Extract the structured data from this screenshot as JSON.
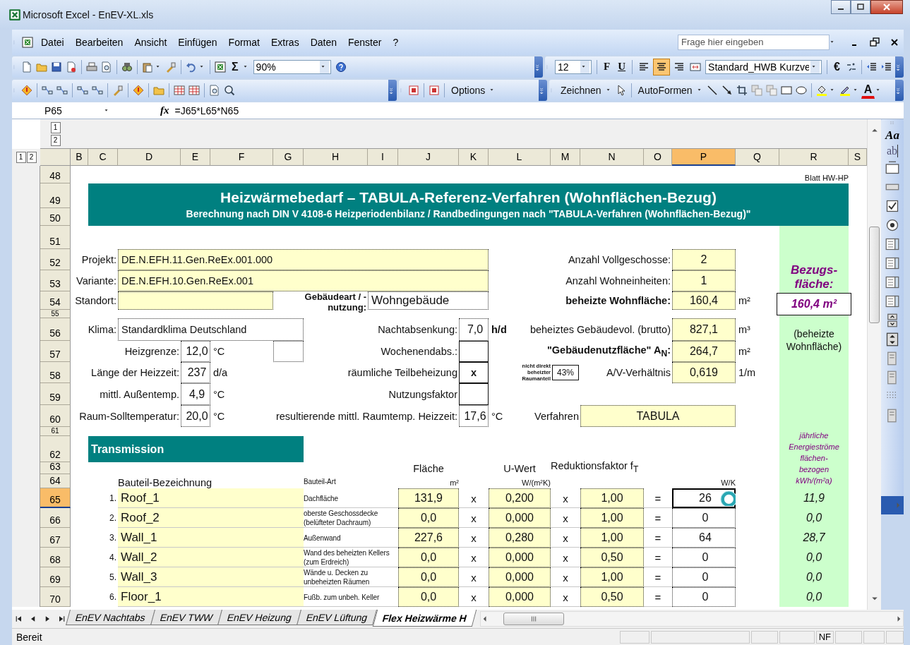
{
  "window": {
    "title": "Microsoft Excel - EnEV-XL.xls"
  },
  "menu": {
    "items": [
      "Datei",
      "Bearbeiten",
      "Ansicht",
      "Einfügen",
      "Format",
      "Extras",
      "Daten",
      "Fenster",
      "?"
    ],
    "help_placeholder": "Frage hier eingeben"
  },
  "toolbar_standard": {
    "sum": "Σ",
    "zoom": "90%"
  },
  "toolbar_format": {
    "font_size": "12",
    "bold": "F",
    "underline": "U",
    "align_buttons": [
      {
        "selected": false
      },
      {
        "selected": true
      },
      {
        "selected": false
      }
    ],
    "style": "Standard_HWB Kurzve",
    "currency": "€"
  },
  "toolbar_extra": {
    "options": "Options",
    "draw": "Zeichnen",
    "autoshapes": "AutoFormen",
    "font_color": "A"
  },
  "formula_bar": {
    "name_box": "P65",
    "fx": "fx",
    "formula": "=J65*L65*N65"
  },
  "outline": {
    "row_levels": [
      "1",
      "2"
    ],
    "column_levels": [
      "1",
      "2"
    ]
  },
  "sheet": {
    "columns": [
      {
        "label": "B",
        "selected": false
      },
      {
        "label": "C",
        "selected": false
      },
      {
        "label": "D",
        "selected": false
      },
      {
        "label": "E",
        "selected": false
      },
      {
        "label": "F",
        "selected": false
      },
      {
        "label": "G",
        "selected": false
      },
      {
        "label": "H",
        "selected": false
      },
      {
        "label": "I",
        "selected": false
      },
      {
        "label": "J",
        "selected": false
      },
      {
        "label": "K",
        "selected": false
      },
      {
        "label": "L",
        "selected": false
      },
      {
        "label": "M",
        "selected": false
      },
      {
        "label": "N",
        "selected": false
      },
      {
        "label": "O",
        "selected": false
      },
      {
        "label": "P",
        "selected": true
      },
      {
        "label": "Q",
        "selected": false
      },
      {
        "label": "R",
        "selected": false
      },
      {
        "label": "S",
        "selected": false
      }
    ],
    "rows": [
      {
        "number": "48",
        "selected": false
      },
      {
        "number": "49",
        "selected": false
      },
      {
        "number": "50",
        "selected": false
      },
      {
        "number": "51",
        "selected": false
      },
      {
        "number": "52",
        "selected": false
      },
      {
        "number": "53",
        "selected": false
      },
      {
        "number": "54",
        "selected": false
      },
      {
        "number": "55",
        "selected": false
      },
      {
        "number": "56",
        "selected": false
      },
      {
        "number": "57",
        "selected": false
      },
      {
        "number": "58",
        "selected": false
      },
      {
        "number": "59",
        "selected": false
      },
      {
        "number": "60",
        "selected": false
      },
      {
        "number": "61",
        "selected": false
      },
      {
        "number": "62",
        "selected": false
      },
      {
        "number": "63",
        "selected": false
      },
      {
        "number": "64",
        "selected": false
      },
      {
        "number": "65",
        "selected": true
      },
      {
        "number": "66",
        "selected": false
      },
      {
        "number": "67",
        "selected": false
      },
      {
        "number": "68",
        "selected": false
      },
      {
        "number": "69",
        "selected": false
      },
      {
        "number": "70",
        "selected": false
      }
    ],
    "cells": {
      "R51:R70": {
        "kind": "band"
      },
      "R48": {
        "kind": "small-right",
        "text": "Blatt HW-HP"
      },
      "C49:R49": {
        "kind": "banner-title",
        "text": "Heizwärmebedarf  –  TABULA-Referenz-Verfahren (Wohnflächen-Bezug)"
      },
      "C50:R50": {
        "kind": "banner-subtitle",
        "text": "Berechnung nach DIN V 4108-6 Heizperiodenbilanz / Randbedingungen nach \"TABULA-Verfahren  (Wohnflächen-Bezug)\""
      },
      "B52:C52": {
        "kind": "label",
        "text": "Projekt:"
      },
      "D52:K52": {
        "kind": "input",
        "text": "DE.N.EFH.11.Gen.ReEx.001.000"
      },
      "L52:O52": {
        "kind": "label",
        "text": "Anzahl Vollgeschosse:"
      },
      "P52": {
        "kind": "input-num",
        "text": "2"
      },
      "B53:C53": {
        "kind": "label",
        "text": "Variante:"
      },
      "D53:K53": {
        "kind": "input",
        "text": "DE.N.EFH.10.Gen.ReEx.001"
      },
      "L53:O53": {
        "kind": "label",
        "text": "Anzahl Wohneinheiten:"
      },
      "P53": {
        "kind": "input-num",
        "text": "1"
      },
      "R52:R53": {
        "kind": "accent-title",
        "text": "Bezugs-fläche:"
      },
      "B54:C54": {
        "kind": "label",
        "text": "Standort:"
      },
      "D54:F54": {
        "kind": "input"
      },
      "H54:H55": {
        "kind": "label-bold-small",
        "text": "Gebäudeart / -nutzung:"
      },
      "I54:K54": {
        "kind": "field-large",
        "text": "Wohngebäude"
      },
      "L54:O54": {
        "kind": "label-bold",
        "text": "beheizte Wohnfläche:"
      },
      "P54": {
        "kind": "input-num",
        "text": "160,4"
      },
      "Q54": {
        "kind": "unit",
        "text": "m²"
      },
      "R54:R55": {
        "kind": "accent-box",
        "text": "160,4 m²"
      },
      "B56:C56": {
        "kind": "label",
        "text": "Klima:"
      },
      "D56:G56": {
        "kind": "field",
        "text": "Standardklima Deutschland"
      },
      "H56:J56": {
        "kind": "label",
        "text": "Nachtabsenkung:"
      },
      "K56": {
        "kind": "field-num",
        "text": "7,0"
      },
      "L56": {
        "kind": "unit-bold",
        "text": "h/d"
      },
      "M56:O56": {
        "kind": "label",
        "text": "beheiztes Gebäudevol. (brutto)"
      },
      "P56": {
        "kind": "input-num",
        "text": "827,1"
      },
      "Q56": {
        "kind": "unit",
        "text": "m³"
      },
      "R56:R57": {
        "kind": "green-note",
        "text": "(beheizte Wohnfläche)"
      },
      "B57:D57": {
        "kind": "label",
        "text": "Heizgrenze:"
      },
      "E57": {
        "kind": "field-num",
        "text": "12,0"
      },
      "F57": {
        "kind": "unit",
        "text": "°C"
      },
      "G57": {
        "kind": "field"
      },
      "H57:J57": {
        "kind": "label",
        "text": "Wochenendabs.:"
      },
      "K57": {
        "kind": "solid"
      },
      "L57:O57": {
        "kind": "label-bold",
        "text": "\"Gebäudenutzfläche\" A$_{N}$:"
      },
      "P57": {
        "kind": "input-num",
        "text": "264,7"
      },
      "Q57": {
        "kind": "unit",
        "text": "m²"
      },
      "B58:D58": {
        "kind": "label",
        "text": "Länge der Heizzeit:"
      },
      "E58": {
        "kind": "field-num",
        "text": "237"
      },
      "F58": {
        "kind": "unit",
        "text": "d/a"
      },
      "H58:J58": {
        "kind": "label",
        "text": "räumliche Teilbeheizung"
      },
      "K58": {
        "kind": "solid",
        "text": "x"
      },
      "L58": {
        "kind": "tiny",
        "text": "nicht direkt\nbeheizter\nRaumanteil"
      },
      "M58": {
        "kind": "solid-small",
        "text": "43%"
      },
      "N58:O58": {
        "kind": "label",
        "text": "A/V-Verhältnis"
      },
      "P58": {
        "kind": "input-num",
        "text": "0,619"
      },
      "Q58": {
        "kind": "unit",
        "text": "1/m"
      },
      "B59:D59": {
        "kind": "label",
        "text": "mittl. Außentemp."
      },
      "E59": {
        "kind": "field-num",
        "text": "4,9"
      },
      "F59": {
        "kind": "unit",
        "text": "°C"
      },
      "H59:J59": {
        "kind": "label",
        "text": "Nutzungsfaktor"
      },
      "K59": {
        "kind": "solid"
      },
      "B60:D60": {
        "kind": "label",
        "text": "Raum-Solltemperatur:"
      },
      "E60": {
        "kind": "field-num",
        "text": "20,0"
      },
      "F60": {
        "kind": "unit",
        "text": "°C"
      },
      "G60:J60": {
        "kind": "label",
        "text": "resultierende mittl. Raumtemp. Heizzeit:"
      },
      "K60": {
        "kind": "field-num",
        "text": "17,6"
      },
      "L60": {
        "kind": "unit",
        "text": "°C"
      },
      "M60": {
        "kind": "label",
        "text": "Verfahren"
      },
      "N60:P60": {
        "kind": "input-num",
        "text": "TABULA"
      },
      "C62:G62": {
        "kind": "section",
        "text": "Transmission"
      },
      "R61:R64": {
        "kind": "accent-note",
        "text": "jährliche\nEnergieströme\nflächen-\nbezogen\nkWh/(m²a)"
      },
      "J63": {
        "kind": "head",
        "text": "Fläche"
      },
      "L63": {
        "kind": "head",
        "text": "U-Wert"
      },
      "M63:O63": {
        "kind": "head-left",
        "text": "Reduktionsfaktor f$_{T}$"
      },
      "D64:G64": {
        "kind": "head-left",
        "text": "Bauteil-Bezeichnung"
      },
      "H64": {
        "kind": "note",
        "text": "Bauteil-Art"
      },
      "J64": {
        "kind": "small-right",
        "text": "m²"
      },
      "L64": {
        "kind": "small-right",
        "text": "W/(m²K)"
      },
      "P64": {
        "kind": "small-right",
        "text": "W/K"
      },
      "C65": {
        "kind": "index",
        "text": "1."
      },
      "D65:G65": {
        "kind": "input-large",
        "text": "Roof_1"
      },
      "H65:I65": {
        "kind": "note",
        "text": "Dachfläche"
      },
      "J65": {
        "kind": "input-num",
        "text": "131,9"
      },
      "K65": {
        "kind": "op",
        "text": "x"
      },
      "L65": {
        "kind": "input-num",
        "text": "0,200"
      },
      "M65": {
        "kind": "op",
        "text": "x"
      },
      "N65": {
        "kind": "input-num",
        "text": "1,00"
      },
      "O65": {
        "kind": "op",
        "text": "="
      },
      "P65": {
        "kind": "field-num",
        "text": "26"
      },
      "R65": {
        "kind": "italic-num",
        "text": "11,9"
      },
      "C66": {
        "kind": "index",
        "text": "2."
      },
      "D66:G66": {
        "kind": "input-large",
        "text": "Roof_2"
      },
      "H66:I66": {
        "kind": "note",
        "text": "oberste Geschossdecke\n(belüfteter Dachraum)"
      },
      "J66": {
        "kind": "input-num",
        "text": "0,0"
      },
      "K66": {
        "kind": "op",
        "text": "x"
      },
      "L66": {
        "kind": "input-num",
        "text": "0,000"
      },
      "M66": {
        "kind": "op",
        "text": "x"
      },
      "N66": {
        "kind": "input-num",
        "text": "1,00"
      },
      "O66": {
        "kind": "op",
        "text": "="
      },
      "P66": {
        "kind": "field-num",
        "text": "0"
      },
      "R66": {
        "kind": "italic-num",
        "text": "0,0"
      },
      "C67": {
        "kind": "index",
        "text": "3."
      },
      "D67:G67": {
        "kind": "input-large",
        "text": "Wall_1"
      },
      "H67:I67": {
        "kind": "note",
        "text": "Außenwand"
      },
      "J67": {
        "kind": "input-num",
        "text": "227,6"
      },
      "K67": {
        "kind": "op",
        "text": "x"
      },
      "L67": {
        "kind": "input-num",
        "text": "0,280"
      },
      "M67": {
        "kind": "op",
        "text": "x"
      },
      "N67": {
        "kind": "input-num",
        "text": "1,00"
      },
      "O67": {
        "kind": "op",
        "text": "="
      },
      "P67": {
        "kind": "field-num",
        "text": "64"
      },
      "R67": {
        "kind": "italic-num",
        "text": "28,7"
      },
      "C68": {
        "kind": "index",
        "text": "4."
      },
      "D68:G68": {
        "kind": "input-large",
        "text": "Wall_2"
      },
      "H68:I68": {
        "kind": "note",
        "text": "Wand des beheizten Kellers\n(zum Erdreich)"
      },
      "J68": {
        "kind": "input-num",
        "text": "0,0"
      },
      "K68": {
        "kind": "op",
        "text": "x"
      },
      "L68": {
        "kind": "input-num",
        "text": "0,000"
      },
      "M68": {
        "kind": "op",
        "text": "x"
      },
      "N68": {
        "kind": "input-num",
        "text": "0,50"
      },
      "O68": {
        "kind": "op",
        "text": "="
      },
      "P68": {
        "kind": "field-num",
        "text": "0"
      },
      "R68": {
        "kind": "italic-num",
        "text": "0,0"
      },
      "C69": {
        "kind": "index",
        "text": "5."
      },
      "D69:G69": {
        "kind": "input-large",
        "text": "Wall_3"
      },
      "H69:I69": {
        "kind": "note",
        "text": "Wände u. Decken zu\nunbeheizten Räumen"
      },
      "J69": {
        "kind": "input-num",
        "text": "0,0"
      },
      "K69": {
        "kind": "op",
        "text": "x"
      },
      "L69": {
        "kind": "input-num",
        "text": "0,000"
      },
      "M69": {
        "kind": "op",
        "text": "x"
      },
      "N69": {
        "kind": "input-num",
        "text": "1,00"
      },
      "O69": {
        "kind": "op",
        "text": "="
      },
      "P69": {
        "kind": "field-num",
        "text": "0"
      },
      "R69": {
        "kind": "italic-num",
        "text": "0,0"
      },
      "C70": {
        "kind": "index",
        "text": "6."
      },
      "D70:G70": {
        "kind": "input-large",
        "text": "Floor_1"
      },
      "H70:I70": {
        "kind": "note",
        "text": "Fußb. zum unbeh. Keller"
      },
      "J70": {
        "kind": "input-num",
        "text": "0,0"
      },
      "K70": {
        "kind": "op",
        "text": "x"
      },
      "L70": {
        "kind": "input-num",
        "text": "0,000"
      },
      "M70": {
        "kind": "op",
        "text": "x"
      },
      "N70": {
        "kind": "input-num",
        "text": "0,50"
      },
      "O70": {
        "kind": "op",
        "text": "="
      },
      "P70": {
        "kind": "field-num",
        "text": "0"
      },
      "R70": {
        "kind": "italic-num",
        "text": "0,0"
      }
    }
  },
  "sheet_tabs": [
    {
      "label": "EnEV Nachtabs",
      "selected": false
    },
    {
      "label": "EnEV TWW",
      "selected": false
    },
    {
      "label": "EnEV Heizung",
      "selected": false
    },
    {
      "label": "EnEV Lüftung",
      "selected": false
    },
    {
      "label": "Flex Heizwärme H",
      "selected": true
    }
  ],
  "drawing_toolbar": {
    "wordart": "Aa",
    "text_field": "ab"
  },
  "status_bar": {
    "text": "Bereit",
    "indicator": "NF"
  }
}
